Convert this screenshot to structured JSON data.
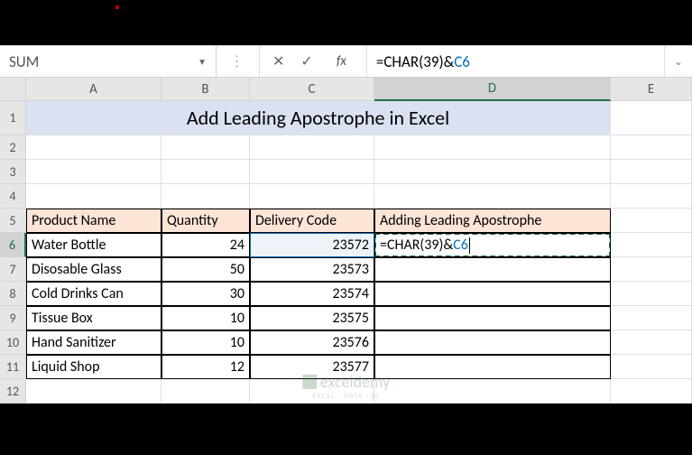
{
  "top": {
    "namebox_value": "SUM",
    "formula_prefix": "=CHAR(39)&",
    "formula_ref": "C6"
  },
  "columns": {
    "A": "A",
    "B": "B",
    "C": "C",
    "D": "D",
    "E": "E"
  },
  "rows": {
    "1": "1",
    "2": "2",
    "3": "3",
    "4": "4",
    "5": "5",
    "6": "6",
    "7": "7",
    "8": "8",
    "9": "9",
    "10": "10",
    "11": "11",
    "12": "12"
  },
  "title": "Add Leading Apostrophe in Excel",
  "headers": {
    "product": "Product Name",
    "qty": "Quantity",
    "code": "Delivery Code",
    "apos": "Adding Leading Apostrophe"
  },
  "data": [
    {
      "product": "Water Bottle",
      "qty": "24",
      "code": "23572"
    },
    {
      "product": "Disosable Glass",
      "qty": "50",
      "code": "23573"
    },
    {
      "product": "Cold Drinks Can",
      "qty": "30",
      "code": "23574"
    },
    {
      "product": "Tissue Box",
      "qty": "10",
      "code": "23575"
    },
    {
      "product": "Hand Sanitizer",
      "qty": "10",
      "code": "23576"
    },
    {
      "product": "Liquid Shop",
      "qty": "12",
      "code": "23577"
    }
  ],
  "editing": {
    "prefix": "=CHAR(39)&",
    "ref": "C6"
  },
  "watermark": {
    "name": "exceldemy",
    "sub": "EXCEL · DATA · BI"
  },
  "icons": {
    "dropdown": "▼",
    "cancel": "✕",
    "enter": "✓",
    "fx": "fx",
    "expand": "⌄"
  }
}
